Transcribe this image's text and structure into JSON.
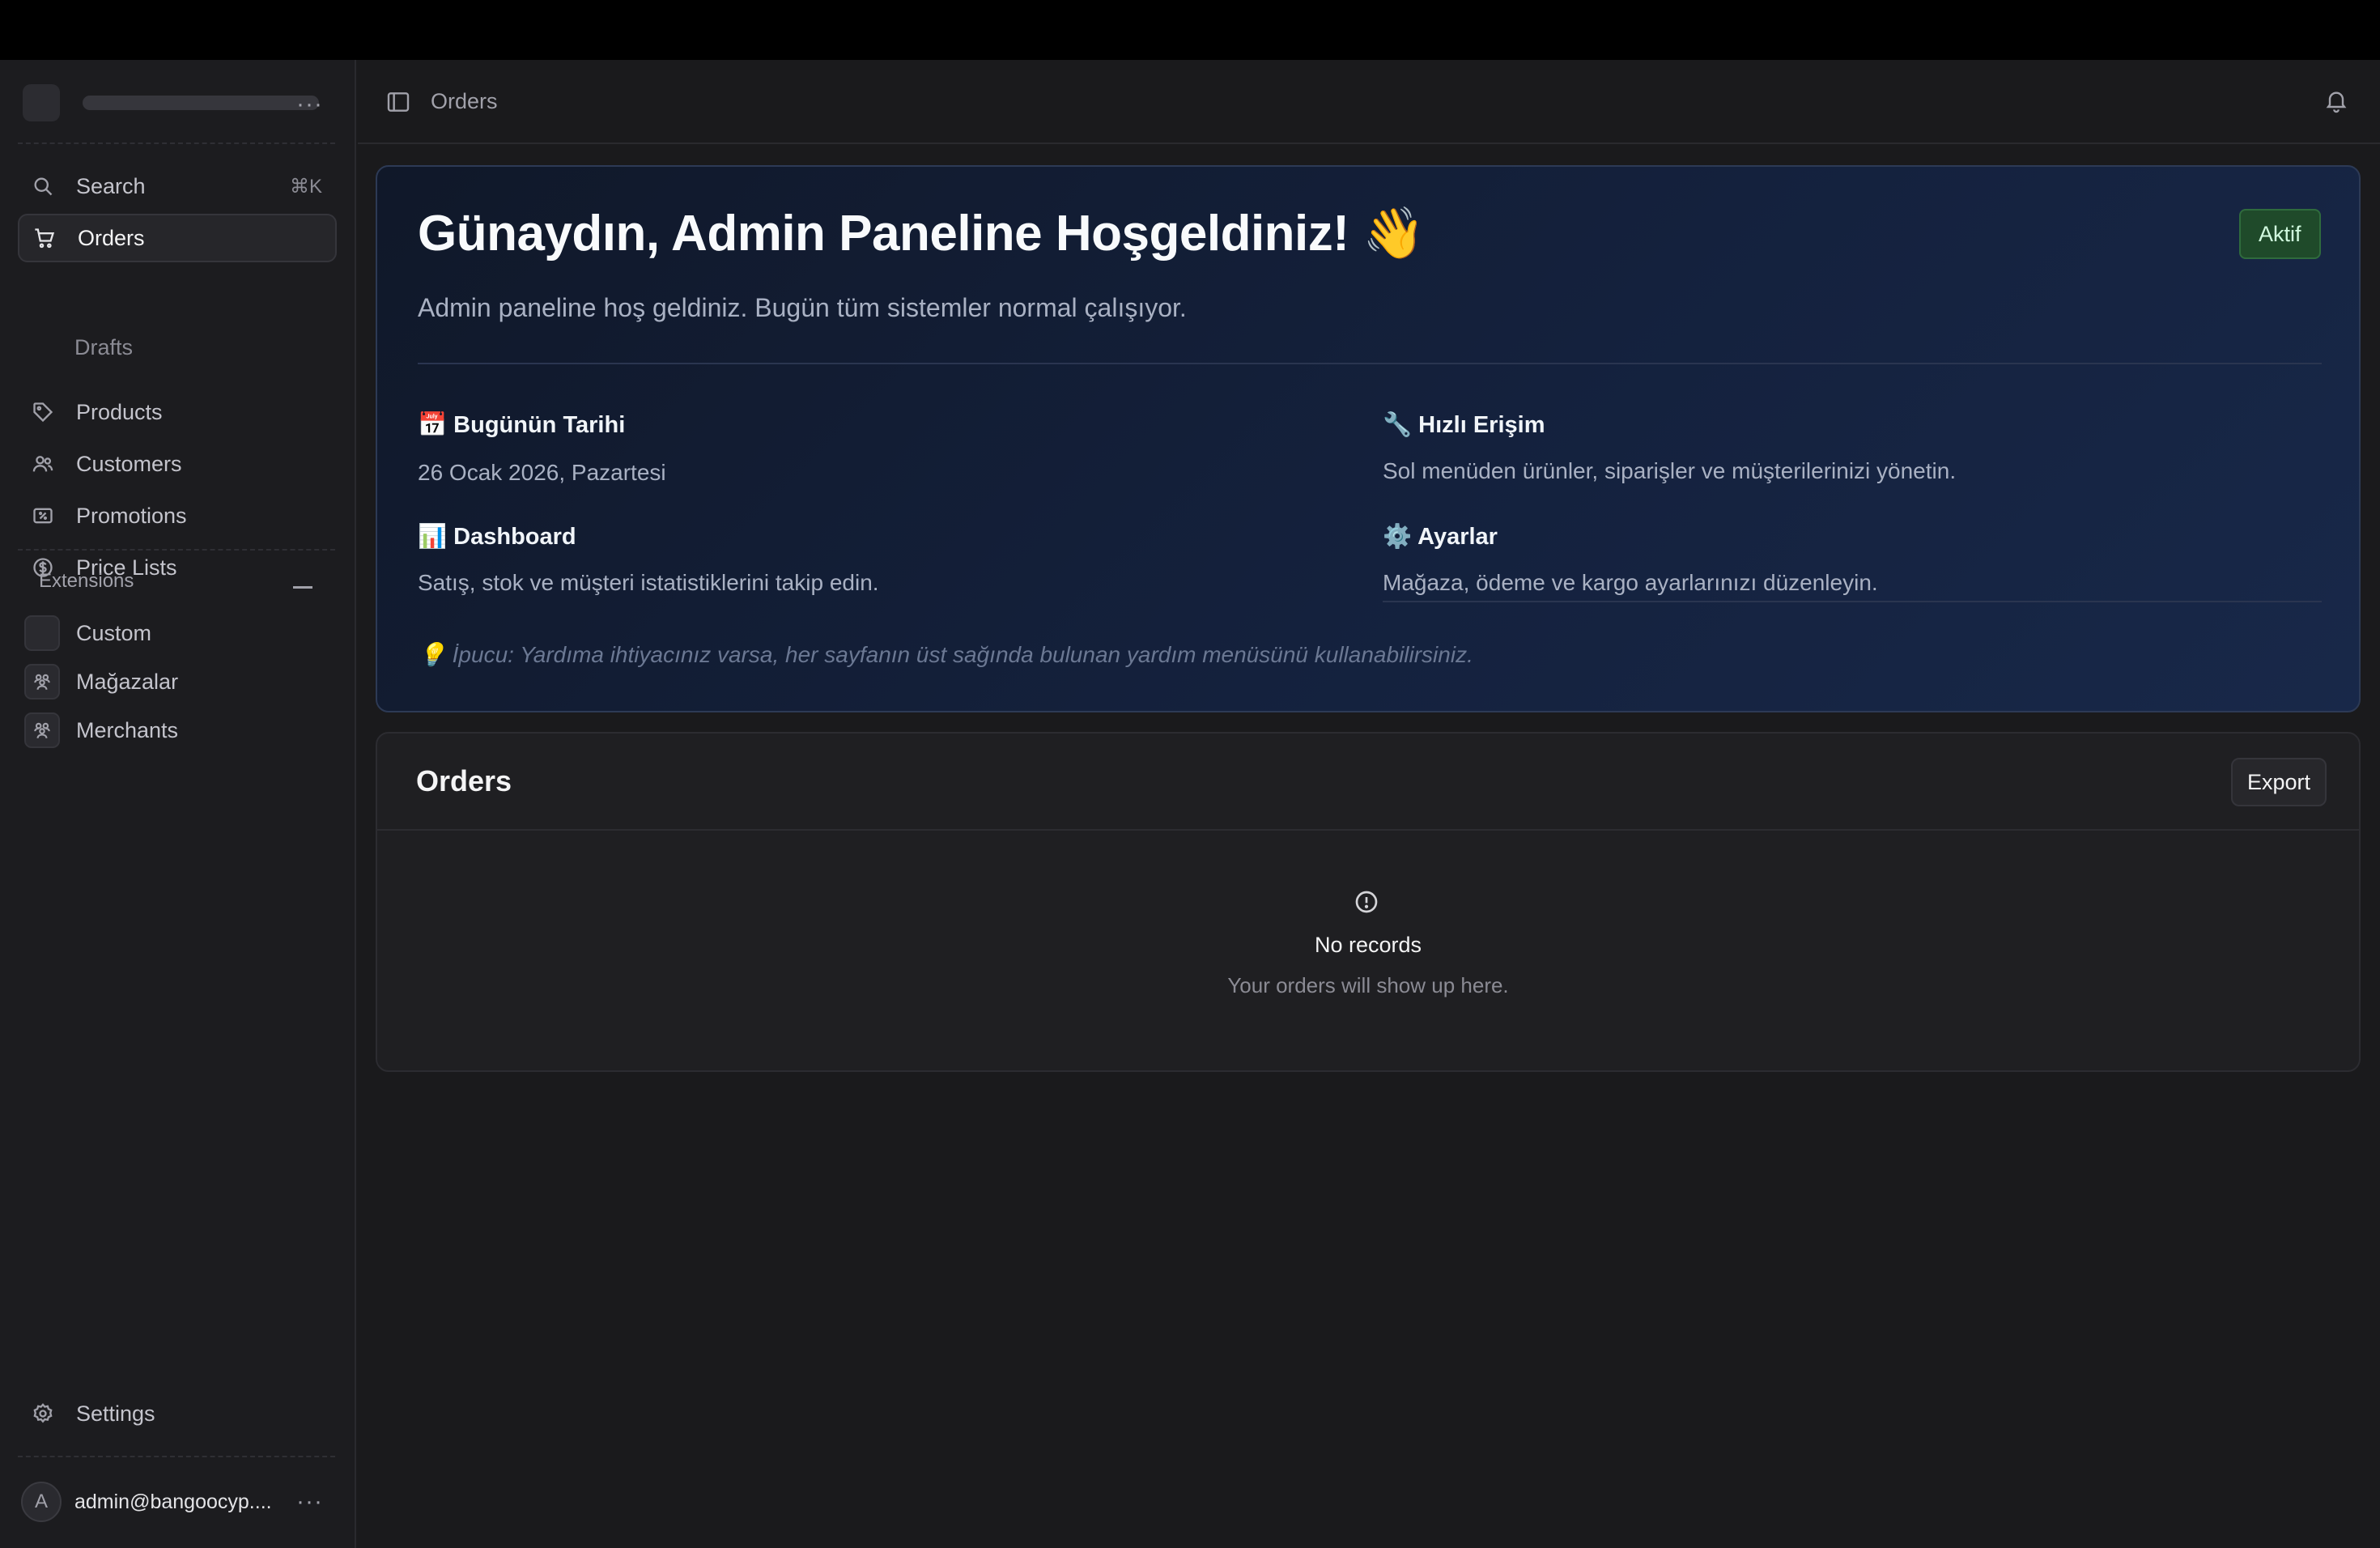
{
  "sidebar": {
    "search": {
      "label": "Search",
      "shortcut": "⌘K"
    },
    "nav": [
      {
        "label": "Orders",
        "icon": "shopping-cart-icon",
        "active": true
      },
      {
        "label": "Drafts"
      },
      {
        "label": "Products",
        "icon": "tag-icon"
      },
      {
        "label": "Customers",
        "icon": "users-icon"
      },
      {
        "label": "Promotions",
        "icon": "receipt-percent-icon"
      },
      {
        "label": "Price Lists",
        "icon": "currency-dollar-icon"
      }
    ],
    "extensions": {
      "header": "Extensions",
      "items": [
        {
          "label": "Custom",
          "icon": "blank-square-icon"
        },
        {
          "label": "Mağazalar",
          "icon": "users-group-icon"
        },
        {
          "label": "Merchants",
          "icon": "users-group-icon"
        }
      ]
    },
    "settings": {
      "label": "Settings",
      "icon": "cog-icon"
    },
    "user": {
      "initial": "A",
      "email": "admin@bangoocyp...."
    }
  },
  "header": {
    "breadcrumb": "Orders"
  },
  "welcome": {
    "title": "Günaydın, Admin Paneline Hoşgeldiniz! 👋",
    "badge": "Aktif",
    "subtitle": "Admin paneline hoş geldiniz. Bugün tüm sistemler normal çalışıyor.",
    "items": [
      {
        "title": "📅 Bugünün Tarihi",
        "text": "26 Ocak 2026, Pazartesi"
      },
      {
        "title": "🔧 Hızlı Erişim",
        "text": "Sol menüden ürünler, siparişler ve müşterilerinizi yönetin."
      },
      {
        "title": "📊 Dashboard",
        "text": "Satış, stok ve müşteri istatistiklerini takip edin."
      },
      {
        "title": "⚙️ Ayarlar",
        "text": "Mağaza, ödeme ve kargo ayarlarınızı düzenleyin."
      }
    ],
    "tip": "💡 İpucu: Yardıma ihtiyacınız varsa, her sayfanın üst sağında bulunan yardım menüsünü kullanabilirsiniz."
  },
  "orders": {
    "title": "Orders",
    "export_label": "Export",
    "empty_title": "No records",
    "empty_subtitle": "Your orders will show up here."
  },
  "colors": {
    "accent_badge": "#1f4a2a",
    "welcome_bg": "#14213d",
    "sidebar_bg": "#1c1c1f"
  }
}
